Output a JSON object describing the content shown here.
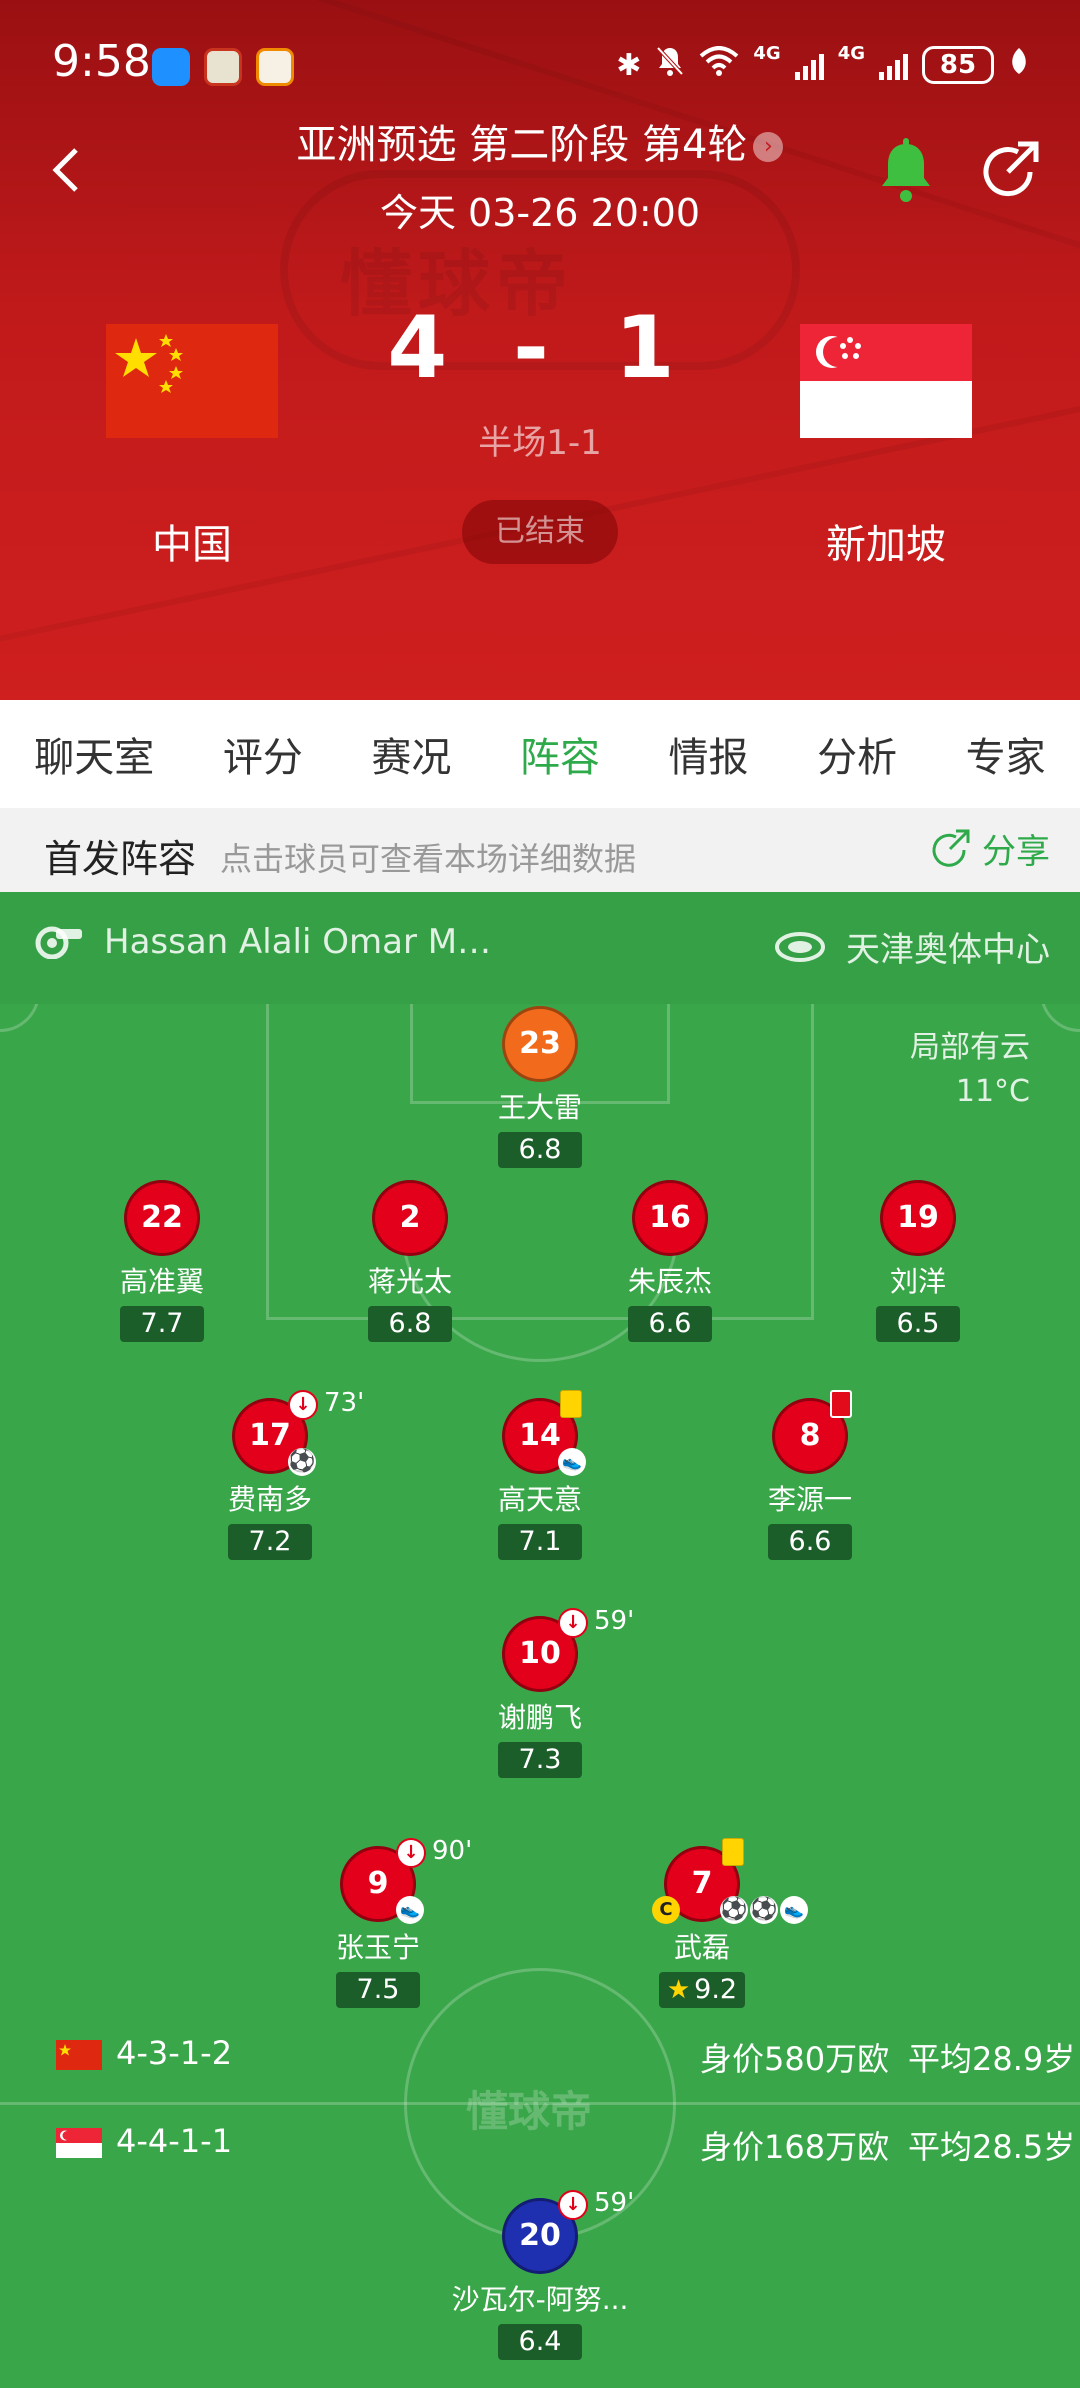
{
  "status_bar": {
    "time": "9:58",
    "network_1": "4G",
    "network_2": "4G",
    "battery": "85"
  },
  "match": {
    "title": "亚洲预选 第二阶段 第4轮",
    "datetime": "今天 03-26 20:00",
    "score": "4 - 1",
    "halftime": "半场1-1",
    "status": "已结束",
    "home_team": "中国",
    "away_team": "新加坡"
  },
  "tabs": [
    "聊天室",
    "评分",
    "赛况",
    "阵容",
    "情报",
    "分析",
    "专家"
  ],
  "active_tab": "阵容",
  "lineup_header": {
    "title": "首发阵容",
    "hint": "点击球员可查看本场详细数据",
    "share": "分享"
  },
  "info": {
    "referee": "Hassan Alali Omar M…",
    "venue": "天津奥体中心",
    "weather": "局部有云",
    "temperature": "11°C"
  },
  "players": {
    "gk": {
      "number": "23",
      "name": "王大雷",
      "rating": "6.8"
    },
    "d1": {
      "number": "22",
      "name": "高准翼",
      "rating": "7.7"
    },
    "d2": {
      "number": "2",
      "name": "蒋光太",
      "rating": "6.8"
    },
    "d3": {
      "number": "16",
      "name": "朱辰杰",
      "rating": "6.6"
    },
    "d4": {
      "number": "19",
      "name": "刘洋",
      "rating": "6.5"
    },
    "m1": {
      "number": "17",
      "name": "费南多",
      "rating": "7.2",
      "sub_minute": "73'"
    },
    "m2": {
      "number": "14",
      "name": "高天意",
      "rating": "7.1"
    },
    "m3": {
      "number": "8",
      "name": "李源一",
      "rating": "6.6"
    },
    "am": {
      "number": "10",
      "name": "谢鹏飞",
      "rating": "7.3",
      "sub_minute": "59'"
    },
    "f1": {
      "number": "9",
      "name": "张玉宁",
      "rating": "7.5",
      "sub_minute": "90'"
    },
    "f2": {
      "number": "7",
      "name": "武磊",
      "rating": "9.2"
    },
    "away_f": {
      "number": "20",
      "name": "沙瓦尔-阿努...",
      "rating": "6.4",
      "sub_minute": "59'"
    }
  },
  "team_stats": {
    "home": {
      "formation": "4-3-1-2",
      "value": "身价580万欧",
      "avg_age": "平均28.9岁"
    },
    "away": {
      "formation": "4-4-1-1",
      "value": "身价168万欧",
      "avg_age": "平均28.5岁"
    }
  },
  "watermark": "懂球帝",
  "colors": {
    "accent": "#2faa4a",
    "header_red": "#c11a1b",
    "player_home": "#e2001a",
    "player_gk": "#f26a1b",
    "player_away": "#1e2fb0",
    "bell": "#3fbf3f"
  }
}
